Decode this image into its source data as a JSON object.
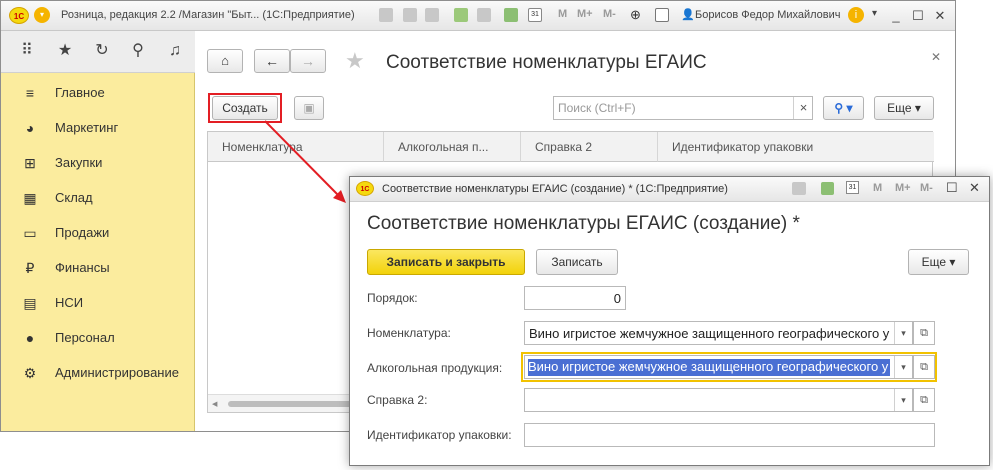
{
  "main_window": {
    "title": "Розница, редакция 2.2 /Магазин \"Быт...  (1С:Предприятие)",
    "toolbar_m_labels": [
      "M",
      "M+",
      "M-"
    ],
    "user": "Борисов Федор Михайлович",
    "sections": [
      {
        "icon": "menu-icon",
        "label": "Главное"
      },
      {
        "icon": "pie-chart-icon",
        "label": "Маркетинг"
      },
      {
        "icon": "cart-icon",
        "label": "Закупки"
      },
      {
        "icon": "warehouse-icon",
        "label": "Склад"
      },
      {
        "icon": "basket-icon",
        "label": "Продажи"
      },
      {
        "icon": "ruble-icon",
        "label": "Финансы"
      },
      {
        "icon": "book-icon",
        "label": "НСИ"
      },
      {
        "icon": "person-icon",
        "label": "Персонал"
      },
      {
        "icon": "gear-icon",
        "label": "Администрирование"
      }
    ]
  },
  "list_form": {
    "title": "Соответствие номенклатуры ЕГАИС",
    "create_button": "Создать",
    "search_placeholder": "Поиск (Ctrl+F)",
    "search_clear": "×",
    "more_button": "Еще",
    "columns": [
      "Номенклатура",
      "Алкогольная п...",
      "Справка 2",
      "Идентификатор упаковки"
    ]
  },
  "dialog": {
    "window_title": "Соответствие номенклатуры ЕГАИС (создание) *  (1С:Предприятие)",
    "toolbar_m_labels": [
      "M",
      "M+",
      "M-"
    ],
    "title": "Соответствие номенклатуры ЕГАИС (создание) *",
    "save_close_button": "Записать и закрыть",
    "save_button": "Записать",
    "more_button": "Еще",
    "fields": {
      "order": {
        "label": "Порядок:",
        "value": "0"
      },
      "nomenclature": {
        "label": "Номенклатура:",
        "value": "Вино игристое жемчужное защищенного географического у"
      },
      "alcohol": {
        "label": "Алкогольная продукция:",
        "value": "Вино игристое жемчужное защищенного географического у"
      },
      "certificate": {
        "label": "Справка 2:",
        "value": ""
      },
      "package_id": {
        "label": "Идентификатор упаковки:",
        "value": ""
      }
    }
  },
  "colors": {
    "sections_bg": "#fbec9e",
    "primary_button": "#f5d90e",
    "highlight_red": "#e31e24",
    "selection_blue": "#4a6fd3",
    "focus_border": "#f2c200"
  }
}
